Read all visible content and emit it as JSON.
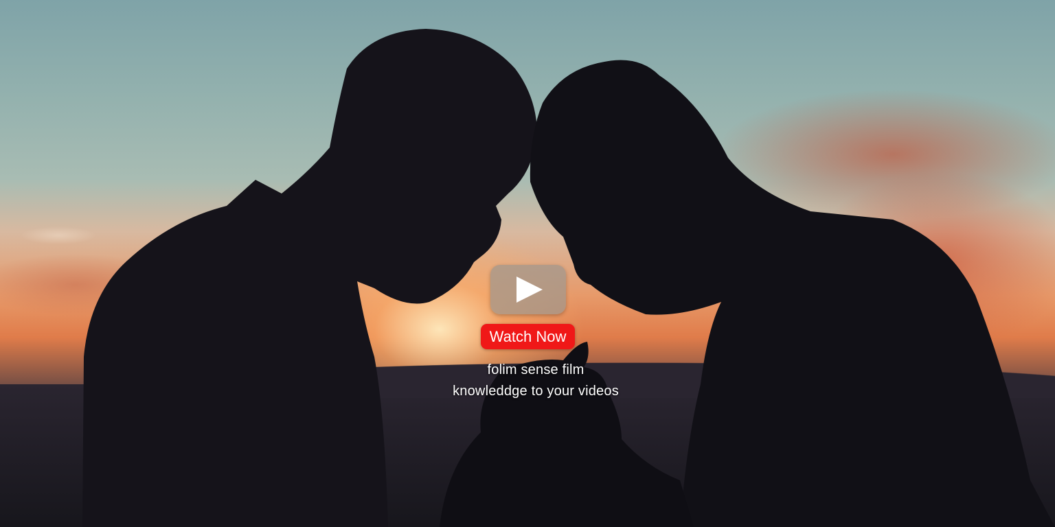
{
  "video": {
    "cta_label": "Watch Now",
    "caption_line1": "folim sense film",
    "caption_line2": "knowleddge to your videos"
  },
  "colors": {
    "cta_background": "#f01818",
    "play_button_background": "#a0968c",
    "play_icon": "#ffffff"
  },
  "icons": {
    "play": "play-icon"
  }
}
